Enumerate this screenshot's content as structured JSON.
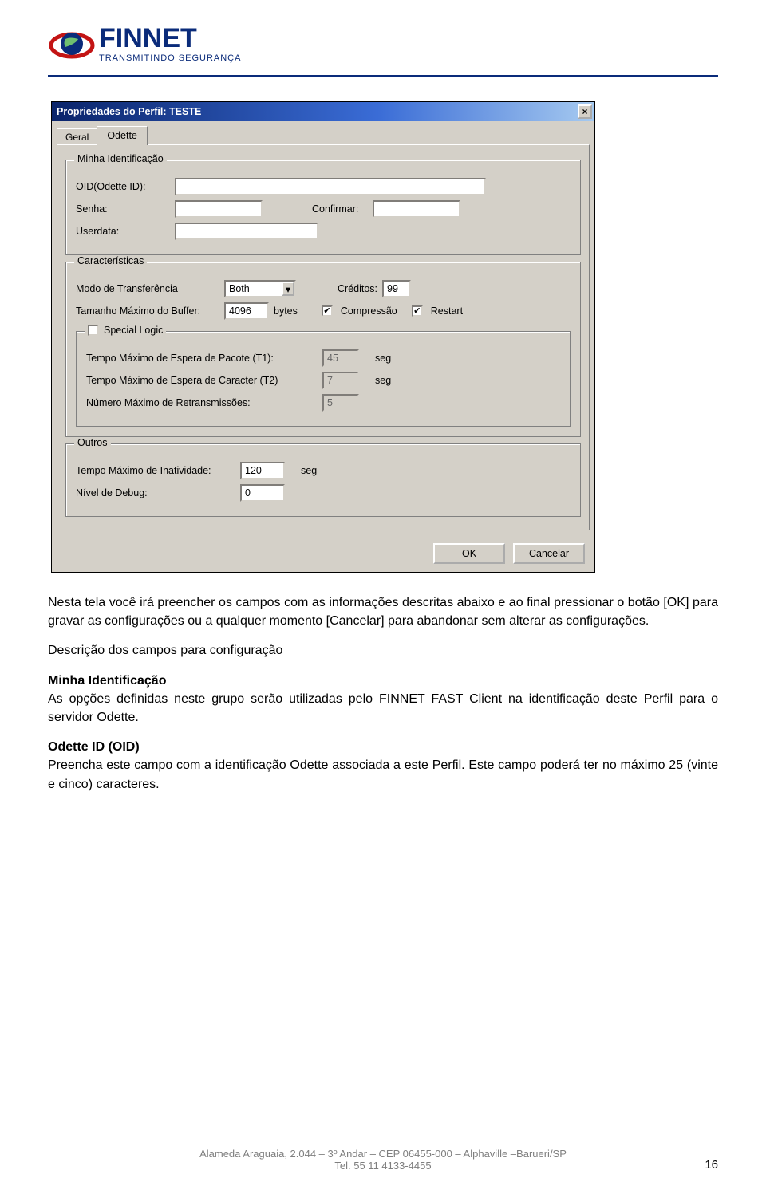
{
  "logo": {
    "name": "Finnet",
    "tagline": "TRANSMITINDO SEGURANÇA"
  },
  "window": {
    "title": "Propriedades do Perfil: TESTE",
    "tabs": {
      "geral": "Geral",
      "odette": "Odette"
    },
    "group_id": {
      "legend": "Minha Identificação",
      "oid_label": "OID(Odette ID):",
      "oid_value": "",
      "senha_label": "Senha:",
      "senha_value": "",
      "confirmar_label": "Confirmar:",
      "confirmar_value": "",
      "userdata_label": "Userdata:",
      "userdata_value": ""
    },
    "group_char": {
      "legend": "Características",
      "modo_label": "Modo de Transferência",
      "modo_value": "Both",
      "creditos_label": "Créditos:",
      "creditos_value": "99",
      "buffer_label": "Tamanho Máximo do Buffer:",
      "buffer_value": "4096",
      "bytes": "bytes",
      "compress_label": "Compressão",
      "restart_label": "Restart",
      "special": {
        "legend": "Special Logic",
        "t1_label": "Tempo Máximo de Espera de Pacote (T1):",
        "t1_value": "45",
        "t2_label": "Tempo Máximo de Espera de Caracter (T2)",
        "t2_value": "7",
        "retrans_label": "Número Máximo de Retransmissões:",
        "retrans_value": "5",
        "seg": "seg"
      }
    },
    "group_other": {
      "legend": "Outros",
      "inact_label": "Tempo Máximo de Inatividade:",
      "inact_value": "120",
      "seg": "seg",
      "debug_label": "Nível de Debug:",
      "debug_value": "0"
    },
    "buttons": {
      "ok": "OK",
      "cancel": "Cancelar"
    }
  },
  "body": {
    "p1": "Nesta tela você irá preencher os campos com as informações descritas abaixo e ao final pressionar o botão [OK] para gravar as configurações ou a qualquer momento [Cancelar] para abandonar sem alterar as configurações.",
    "p2": "Descrição dos campos para configuração",
    "h1": "Minha Identificação",
    "p3": "As opções definidas neste grupo serão utilizadas pelo FINNET FAST Client na identificação deste Perfil para o servidor Odette.",
    "h2": "Odette ID (OID)",
    "p4": "Preencha este campo com a identificação Odette associada a este Perfil. Este campo poderá ter no máximo 25 (vinte e cinco) caracteres."
  },
  "footer": {
    "line1": "Alameda Araguaia, 2.044 – 3º Andar – CEP 06455-000 – Alphaville –Barueri/SP",
    "line2": "Tel. 55 11 4133-4455",
    "page": "16"
  }
}
